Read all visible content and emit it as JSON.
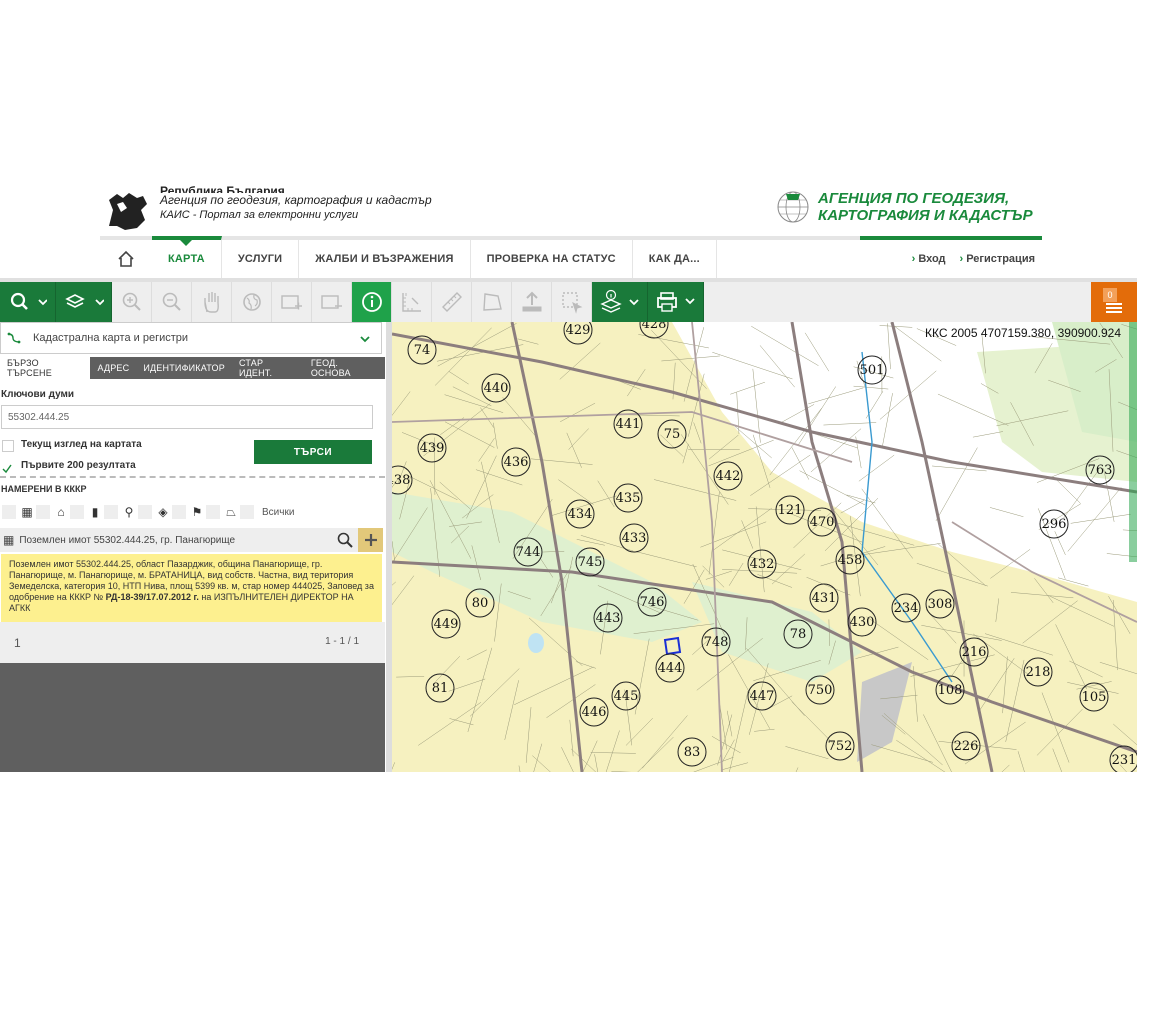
{
  "header": {
    "gov_line": "Република България",
    "agency_line": "Агенция по геодезия, картография и кадастър",
    "portal_line": "КАИС - Портал за електронни услуги",
    "agency_logo_line1": "АГЕНЦИЯ ПО ГЕОДЕЗИЯ,",
    "agency_logo_line2": "КАРТОГРАФИЯ И КАДАСТЪР"
  },
  "nav": {
    "items": [
      {
        "label": "КАРТА"
      },
      {
        "label": "УСЛУГИ"
      },
      {
        "label": "ЖАЛБИ И ВЪЗРАЖЕНИЯ"
      },
      {
        "label": "ПРОВЕРКА НА СТАТУС"
      },
      {
        "label": "КАК ДА..."
      }
    ],
    "login": "Вход",
    "register": "Регистрация"
  },
  "toolbar": {
    "cart_count": "0"
  },
  "panel": {
    "layer_select": "Кадастрална карта и регистри",
    "tabs": [
      "БЪРЗО ТЪРСЕНЕ",
      "АДРЕС",
      "ИДЕНТИФИКАТОР",
      "СТАР ИДЕНТ.",
      "ГЕОД. ОСНОВА"
    ],
    "keywords_label": "Ключови думи",
    "keywords_value": "55302.444.25",
    "current_view_label": "Текущ изглед на картата",
    "first_200_label": "Първите 200 резултата",
    "search_button": "ТЪРСИ",
    "found_label": "НАМЕРЕНИ В КККР",
    "all_label": "Всички",
    "result_title": "Поземлен имот 55302.444.25, гр. Панагюрище",
    "result_text_1": "Поземлен имот 55302.444.25, област Пазарджик, община Панагюрище, гр. Панагюрище, м. Панагюрище, м. БРАТАНИЦА, вид собств. Частна, вид територия Земеделска, категория 10, НТП Нива, площ 5399 кв. м, стар номер 444025, Заповед за одобрение на КККР №",
    "result_text_bold": "РД-18-39/17.07.2012 г.",
    "result_text_2": "на ИЗПЪЛНИТЕЛЕН ДИРЕКТОР НА АГКК",
    "page_number": "1",
    "page_range": "1 - 1 / 1"
  },
  "map": {
    "coordinates": "ККС 2005 4707159.380, 390900.924",
    "parcel_labels": [
      "429",
      "428",
      "74",
      "440",
      "441",
      "75",
      "501",
      "439",
      "436",
      "442",
      "763",
      "438",
      "435",
      "121",
      "470",
      "296",
      "434",
      "433",
      "744",
      "745",
      "432",
      "458",
      "80",
      "746",
      "431",
      "234",
      "308",
      "449",
      "443",
      "748",
      "78",
      "430",
      "216",
      "444",
      "447",
      "750",
      "108",
      "218",
      "105",
      "81",
      "445",
      "446",
      "752",
      "226",
      "231",
      "83"
    ]
  }
}
